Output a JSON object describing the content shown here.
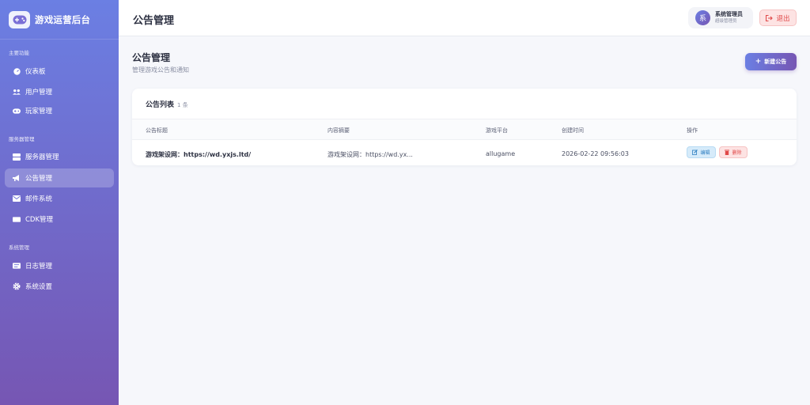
{
  "brand": {
    "title": "游戏运营后台"
  },
  "sidebar": {
    "sections": [
      {
        "label": "主要功能",
        "items": [
          {
            "label": "仪表板",
            "icon": "dashboard-icon"
          },
          {
            "label": "用户管理",
            "icon": "users-icon"
          },
          {
            "label": "玩家管理",
            "icon": "gamepad-icon"
          }
        ]
      },
      {
        "label": "服务器管理",
        "items": [
          {
            "label": "服务器管理",
            "icon": "server-icon"
          },
          {
            "label": "公告管理",
            "icon": "megaphone-icon",
            "active": true
          },
          {
            "label": "邮件系统",
            "icon": "mail-icon"
          },
          {
            "label": "CDK管理",
            "icon": "ticket-icon"
          }
        ]
      },
      {
        "label": "系统管理",
        "items": [
          {
            "label": "日志管理",
            "icon": "log-icon"
          },
          {
            "label": "系统设置",
            "icon": "gear-icon"
          }
        ]
      }
    ]
  },
  "header": {
    "title": "公告管理",
    "user": {
      "avatar_char": "系",
      "name": "系统管理员",
      "role": "超级管理员"
    },
    "logout_label": "退出"
  },
  "main": {
    "title": "公告管理",
    "subtitle": "管理游戏公告和通知",
    "new_button_label": "新建公告"
  },
  "table": {
    "title": "公告列表",
    "count": "1 条",
    "columns": [
      "公告标题",
      "内容摘要",
      "游戏平台",
      "创建时间",
      "操作"
    ],
    "rows": [
      {
        "title": "游戏架设网：https://wd.yxjs.ltd/",
        "summary": "游戏架设网：https://wd.yx...",
        "platform": "allugame",
        "created": "2026-02-22 09:56:03",
        "edit_label": "编辑",
        "delete_label": "删除"
      }
    ]
  },
  "colors": {
    "accent_start": "#6b7fe3",
    "accent_end": "#7656b3",
    "danger": "#e04848",
    "info": "#2f7fc1"
  }
}
